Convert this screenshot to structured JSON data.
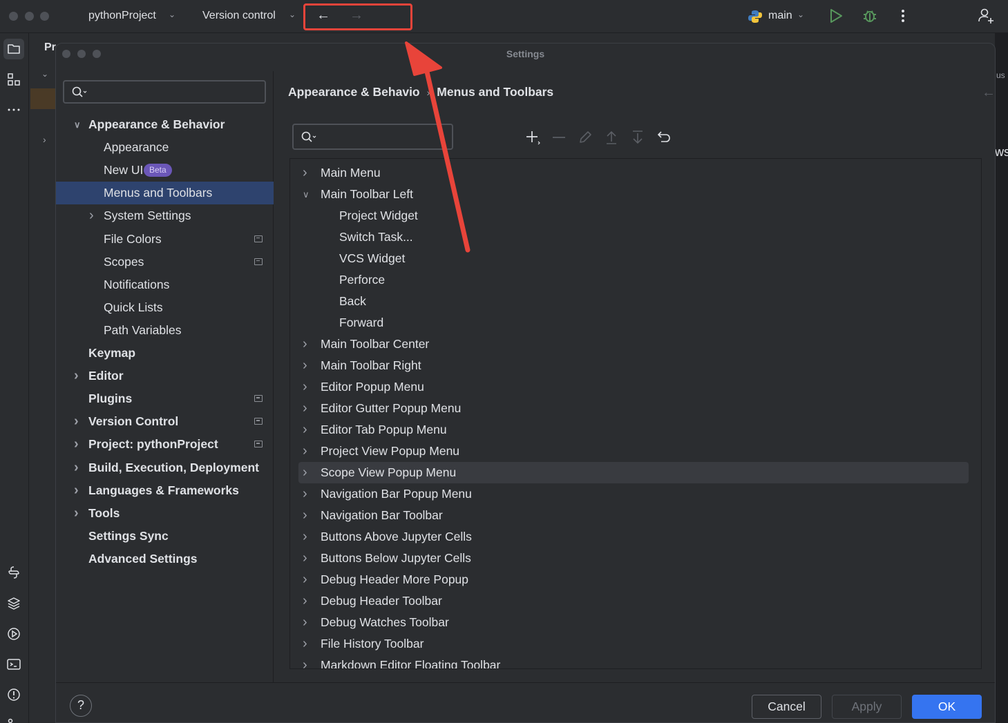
{
  "titlebar": {
    "project": "pythonProject",
    "vcs": "Version control",
    "branch": "main"
  },
  "behind": {
    "proj_label": "Pr",
    "right_text_a": "us",
    "right_text_b": "ws"
  },
  "dialog": {
    "title": "Settings",
    "search_placeholder": "",
    "sidebar": [
      {
        "label": "Appearance & Behavior",
        "bold": true,
        "expanded": true,
        "level": 0
      },
      {
        "label": "Appearance",
        "level": 1
      },
      {
        "label": "New UI",
        "level": 1,
        "badge": "Beta"
      },
      {
        "label": "Menus and Toolbars",
        "level": 1,
        "selected": true
      },
      {
        "label": "System Settings",
        "level": 1,
        "collapsed": true
      },
      {
        "label": "File Colors",
        "level": 1,
        "project_icon": true
      },
      {
        "label": "Scopes",
        "level": 1,
        "project_icon": true
      },
      {
        "label": "Notifications",
        "level": 1
      },
      {
        "label": "Quick Lists",
        "level": 1
      },
      {
        "label": "Path Variables",
        "level": 1
      },
      {
        "label": "Keymap",
        "bold": true,
        "level": 0
      },
      {
        "label": "Editor",
        "bold": true,
        "collapsed": true,
        "level": 0
      },
      {
        "label": "Plugins",
        "bold": true,
        "level": 0,
        "project_icon": true
      },
      {
        "label": "Version Control",
        "bold": true,
        "collapsed": true,
        "level": 0,
        "project_icon": true
      },
      {
        "label": "Project: pythonProject",
        "bold": true,
        "collapsed": true,
        "level": 0,
        "project_icon": true
      },
      {
        "label": "Build, Execution, Deployment",
        "bold": true,
        "collapsed": true,
        "level": 0
      },
      {
        "label": "Languages & Frameworks",
        "bold": true,
        "collapsed": true,
        "level": 0
      },
      {
        "label": "Tools",
        "bold": true,
        "collapsed": true,
        "level": 0
      },
      {
        "label": "Settings Sync",
        "bold": true,
        "level": 0
      },
      {
        "label": "Advanced Settings",
        "bold": true,
        "level": 0
      }
    ],
    "breadcrumb": {
      "parent": "Appearance & Behavio",
      "separator": "›",
      "current": "Menus and Toolbars"
    },
    "actions_list": [
      {
        "label": "Main Menu",
        "level": 0,
        "chevron": "collapsed"
      },
      {
        "label": "Main Toolbar Left",
        "level": 0,
        "chevron": "expanded"
      },
      {
        "label": "Project Widget",
        "level": 1
      },
      {
        "label": "Switch Task...",
        "level": 1
      },
      {
        "label": "VCS Widget",
        "level": 1
      },
      {
        "label": "Perforce",
        "level": 1
      },
      {
        "label": "Back",
        "level": 1
      },
      {
        "label": "Forward",
        "level": 1
      },
      {
        "label": "Main Toolbar Center",
        "level": 0,
        "chevron": "collapsed"
      },
      {
        "label": "Main Toolbar Right",
        "level": 0,
        "chevron": "collapsed"
      },
      {
        "label": "Editor Popup Menu",
        "level": 0,
        "chevron": "collapsed"
      },
      {
        "label": "Editor Gutter Popup Menu",
        "level": 0,
        "chevron": "collapsed"
      },
      {
        "label": "Editor Tab Popup Menu",
        "level": 0,
        "chevron": "collapsed"
      },
      {
        "label": "Project View Popup Menu",
        "level": 0,
        "chevron": "collapsed"
      },
      {
        "label": "Scope View Popup Menu",
        "level": 0,
        "chevron": "collapsed",
        "hover": true
      },
      {
        "label": "Navigation Bar Popup Menu",
        "level": 0,
        "chevron": "collapsed"
      },
      {
        "label": "Navigation Bar Toolbar",
        "level": 0,
        "chevron": "collapsed"
      },
      {
        "label": "Buttons Above Jupyter Cells",
        "level": 0,
        "chevron": "collapsed"
      },
      {
        "label": "Buttons Below Jupyter Cells",
        "level": 0,
        "chevron": "collapsed"
      },
      {
        "label": "Debug Header More Popup",
        "level": 0,
        "chevron": "collapsed"
      },
      {
        "label": "Debug Header Toolbar",
        "level": 0,
        "chevron": "collapsed"
      },
      {
        "label": "Debug Watches Toolbar",
        "level": 0,
        "chevron": "collapsed"
      },
      {
        "label": "File History Toolbar",
        "level": 0,
        "chevron": "collapsed"
      },
      {
        "label": "Markdown Editor Floating Toolbar",
        "level": 0,
        "chevron": "collapsed"
      }
    ],
    "footer": {
      "help": "?",
      "cancel": "Cancel",
      "apply": "Apply",
      "ok": "OK"
    }
  },
  "colors": {
    "selection": "#2e436e",
    "ok_button": "#3574f0",
    "annotation": "#e8443a",
    "run_green": "#57965c"
  }
}
